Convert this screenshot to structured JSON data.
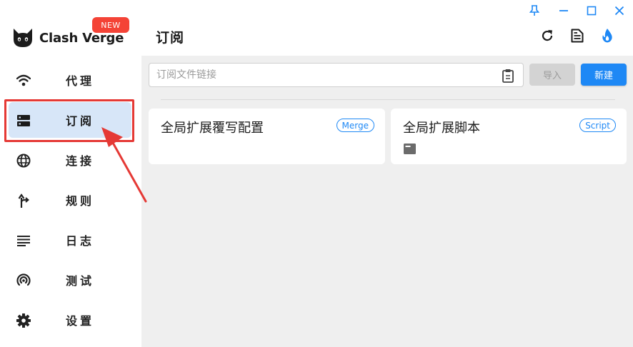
{
  "app": {
    "brand": "Clash Verge",
    "new_badge": "NEW"
  },
  "sidebar": {
    "items": [
      {
        "label": "代理",
        "icon": "wifi-icon"
      },
      {
        "label": "订阅",
        "icon": "dns-server-icon",
        "active": true
      },
      {
        "label": "连接",
        "icon": "globe-icon"
      },
      {
        "label": "规则",
        "icon": "fork-arrow-icon"
      },
      {
        "label": "日志",
        "icon": "list-lines-icon"
      },
      {
        "label": "测试",
        "icon": "radar-icon"
      },
      {
        "label": "设置",
        "icon": "gear-icon"
      }
    ]
  },
  "header": {
    "title": "订阅"
  },
  "toolbar": {
    "url_placeholder": "订阅文件链接",
    "import_label": "导入",
    "new_label": "新建"
  },
  "cards": [
    {
      "title": "全局扩展覆写配置",
      "tag": "Merge"
    },
    {
      "title": "全局扩展脚本",
      "tag": "Script"
    }
  ],
  "colors": {
    "accent": "#1e88f5",
    "active_bg": "#d7e6f8",
    "highlight": "#e53935",
    "badge": "#f44336",
    "flame": "#1e88f5"
  }
}
